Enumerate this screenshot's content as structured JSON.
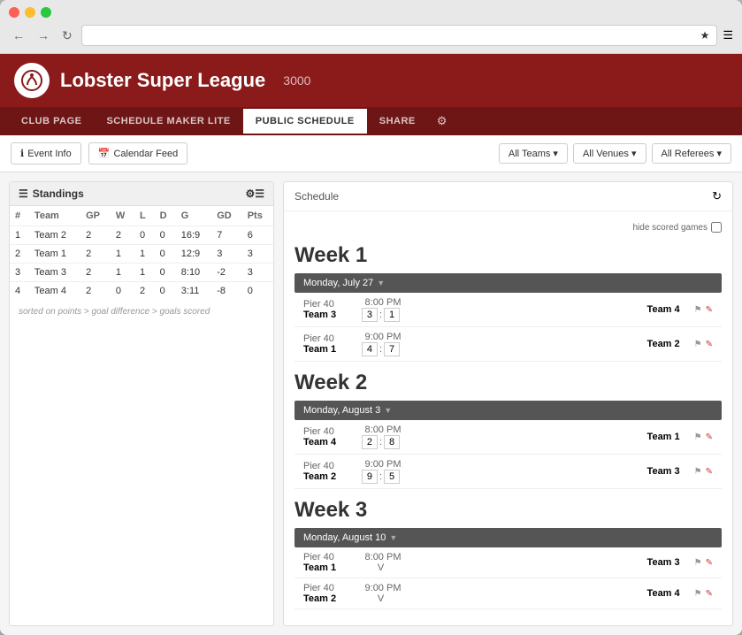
{
  "browser": {
    "back_btn": "←",
    "forward_btn": "→",
    "refresh_btn": "↻",
    "address": "",
    "bookmark_icon": "★",
    "menu_icon": "☰"
  },
  "header": {
    "logo_text": "🏆",
    "title": "Lobster Super League",
    "subtitle": "3000"
  },
  "nav": {
    "tabs": [
      {
        "label": "CLUB PAGE",
        "active": false
      },
      {
        "label": "SCHEDULE MAKER LITE",
        "active": false
      },
      {
        "label": "PUBLIC SCHEDULE",
        "active": true
      },
      {
        "label": "SHARE",
        "active": false
      }
    ],
    "more_icon": "⚙"
  },
  "toolbar": {
    "event_info_label": "Event Info",
    "calendar_feed_label": "Calendar Feed",
    "all_teams_label": "All Teams ▾",
    "all_venues_label": "All Venues ▾",
    "all_referees_label": "All Referees ▾"
  },
  "standings": {
    "title": "Standings",
    "settings_icon": "⚙",
    "columns": [
      "#",
      "Team",
      "GP",
      "W",
      "L",
      "D",
      "G",
      "GD",
      "Pts"
    ],
    "rows": [
      {
        "rank": "1",
        "team": "Team 2",
        "gp": "2",
        "w": "2",
        "l": "0",
        "d": "0",
        "g": "16:9",
        "gd": "7",
        "pts": "6"
      },
      {
        "rank": "2",
        "team": "Team 1",
        "gp": "2",
        "w": "1",
        "l": "1",
        "d": "0",
        "g": "12:9",
        "gd": "3",
        "pts": "3"
      },
      {
        "rank": "3",
        "team": "Team 3",
        "gp": "2",
        "w": "1",
        "l": "1",
        "d": "0",
        "g": "8:10",
        "gd": "-2",
        "pts": "3"
      },
      {
        "rank": "4",
        "team": "Team 4",
        "gp": "2",
        "w": "0",
        "l": "2",
        "d": "0",
        "g": "3:11",
        "gd": "-8",
        "pts": "0"
      }
    ],
    "note": "sorted on points > goal difference > goals scored"
  },
  "schedule": {
    "title": "Schedule",
    "refresh_icon": "↻",
    "hide_scored_label": "hide scored games",
    "weeks": [
      {
        "label": "Week 1",
        "days": [
          {
            "date": "Monday, July 27",
            "games": [
              {
                "venue": "Pier 40",
                "time": "8:00 PM",
                "home": "Team 3",
                "score_home": "3",
                "score_away": "1",
                "away": "Team 4"
              },
              {
                "venue": "Pier 40",
                "time": "9:00 PM",
                "home": "Team 1",
                "score_home": "4",
                "score_away": "7",
                "away": "Team 2"
              }
            ]
          }
        ]
      },
      {
        "label": "Week 2",
        "days": [
          {
            "date": "Monday, August 3",
            "games": [
              {
                "venue": "Pier 40",
                "time": "8:00 PM",
                "home": "Team 4",
                "score_home": "2",
                "score_away": "8",
                "away": "Team 1"
              },
              {
                "venue": "Pier 40",
                "time": "9:00 PM",
                "home": "Team 2",
                "score_home": "9",
                "score_away": "5",
                "away": "Team 3"
              }
            ]
          }
        ]
      },
      {
        "label": "Week 3",
        "days": [
          {
            "date": "Monday, August 10",
            "games": [
              {
                "venue": "Pier 40",
                "time": "8:00 PM",
                "home": "Team 1",
                "score_home": "V",
                "score_away": "",
                "away": "Team 3",
                "is_vs": true
              },
              {
                "venue": "Pier 40",
                "time": "9:00 PM",
                "home": "Team 2",
                "score_home": "V",
                "score_away": "",
                "away": "Team 4",
                "is_vs": true
              }
            ]
          }
        ]
      }
    ]
  }
}
